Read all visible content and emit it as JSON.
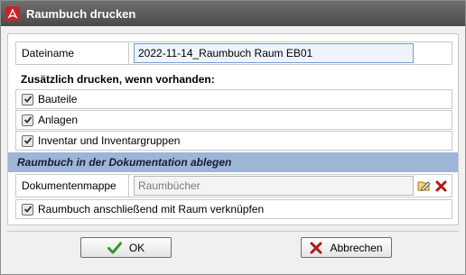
{
  "window": {
    "title": "Raumbuch drucken",
    "icon": "pdf-icon",
    "title_bar_color": "#4f4f4f"
  },
  "filename": {
    "label": "Dateiname",
    "value": "2022-11-14_Raumbuch Raum EB01"
  },
  "extra_print": {
    "heading": "Zusätzlich drucken, wenn vorhanden:",
    "options": [
      {
        "label": "Bauteile",
        "checked": true
      },
      {
        "label": "Anlagen",
        "checked": true
      },
      {
        "label": "Inventar und Inventargruppen",
        "checked": true
      }
    ]
  },
  "documentation": {
    "section_title": "Raumbuch in der Dokumentation ablegen",
    "folder_label": "Dokumentenmappe",
    "folder_value": "Raumbücher",
    "edit_icon": "folder-edit-icon",
    "clear_icon": "clear-x-icon",
    "link_option": {
      "label": "Raumbuch anschließend mit Raum verknüpfen",
      "checked": true
    },
    "section_color": "#9db5d6"
  },
  "buttons": {
    "ok_label": "OK",
    "cancel_label": "Abbrechen",
    "ok_icon": "check-icon",
    "cancel_icon": "x-icon"
  }
}
